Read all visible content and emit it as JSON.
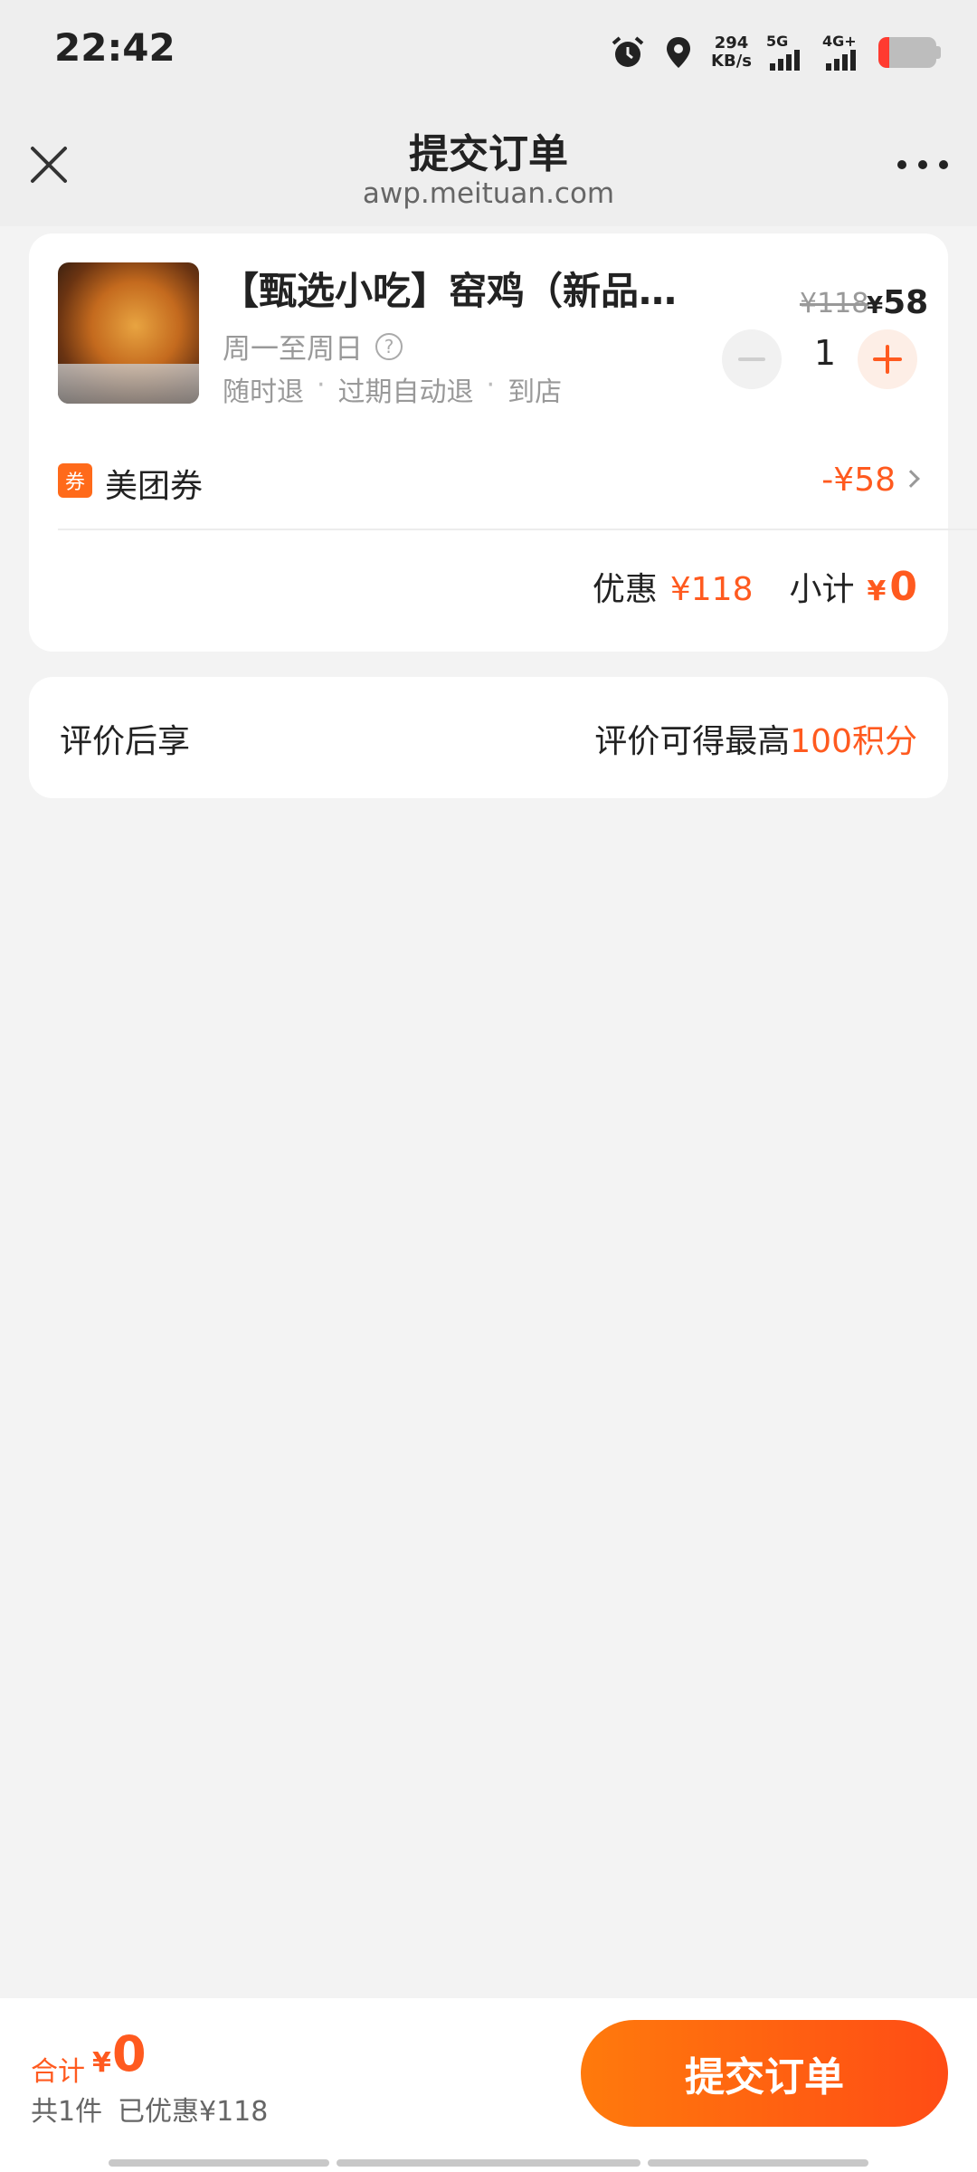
{
  "status_bar": {
    "time": "22:42",
    "net_speed_value": "294",
    "net_speed_unit": "KB/s",
    "sim1": "5G",
    "sim2": "4G+"
  },
  "nav": {
    "title": "提交订单",
    "subtitle": "awp.meituan.com"
  },
  "order": {
    "product_title": "【甄选小吃】窑鸡（新品…",
    "days": "周一至周日",
    "help_icon_glyph": "?",
    "tags": [
      "随时退",
      "过期自动退",
      "到店"
    ],
    "tag_separator": "·",
    "price_old": "¥118",
    "price_now_symbol": "¥",
    "price_now_value": "58",
    "quantity": "1",
    "coupon_badge": "券",
    "coupon_label": "美团券",
    "coupon_amount": "-¥58",
    "discount_label": "优惠",
    "discount_value": "¥118",
    "subtotal_label": "小计",
    "subtotal_symbol": "¥",
    "subtotal_value": "0"
  },
  "review": {
    "left": "评价后享",
    "right_prefix": "评价可得最高",
    "right_highlight": "100积分"
  },
  "footer": {
    "total_label": "合计",
    "total_symbol": "¥",
    "total_value": "0",
    "item_count": "共1件",
    "saved": "已优惠¥118",
    "submit": "提交订单"
  },
  "colors": {
    "accent": "#ff5a1f",
    "background": "#f3f3f3"
  },
  "icons": [
    "close-icon",
    "more-icon",
    "help-icon",
    "chevron-right-icon",
    "minus-icon",
    "plus-icon",
    "alarm-icon",
    "location-icon",
    "battery-icon"
  ]
}
